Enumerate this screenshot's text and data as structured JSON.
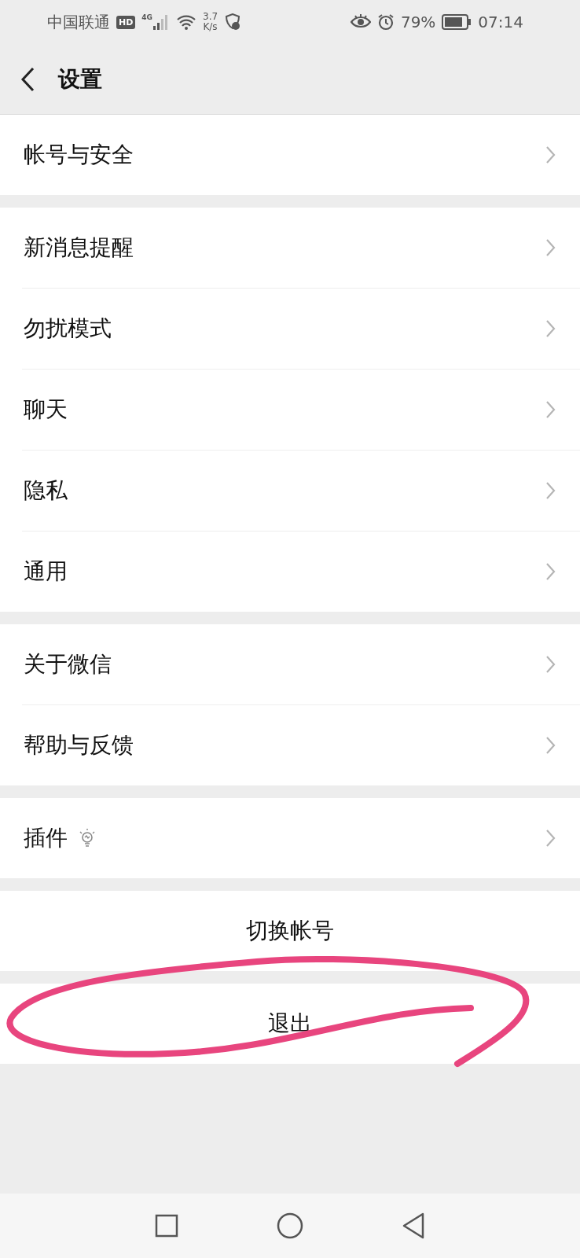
{
  "status_bar": {
    "carrier": "中国联通",
    "hd": "HD",
    "network": "4G",
    "speed_value": "3.7",
    "speed_unit": "K/s",
    "battery": "79%",
    "time": "07:14"
  },
  "header": {
    "title": "设置"
  },
  "sections": [
    {
      "items": [
        {
          "kind": "nav",
          "label": "帐号与安全"
        }
      ]
    },
    {
      "items": [
        {
          "kind": "nav",
          "label": "新消息提醒"
        },
        {
          "kind": "nav",
          "label": "勿扰模式"
        },
        {
          "kind": "nav",
          "label": "聊天"
        },
        {
          "kind": "nav",
          "label": "隐私"
        },
        {
          "kind": "nav",
          "label": "通用"
        }
      ]
    },
    {
      "items": [
        {
          "kind": "nav",
          "label": "关于微信"
        },
        {
          "kind": "nav",
          "label": "帮助与反馈"
        }
      ]
    },
    {
      "items": [
        {
          "kind": "nav",
          "label": "插件",
          "hint_icon": true
        }
      ]
    },
    {
      "items": [
        {
          "kind": "action",
          "label": "切换帐号"
        }
      ]
    },
    {
      "items": [
        {
          "kind": "action",
          "label": "退出"
        }
      ]
    }
  ]
}
